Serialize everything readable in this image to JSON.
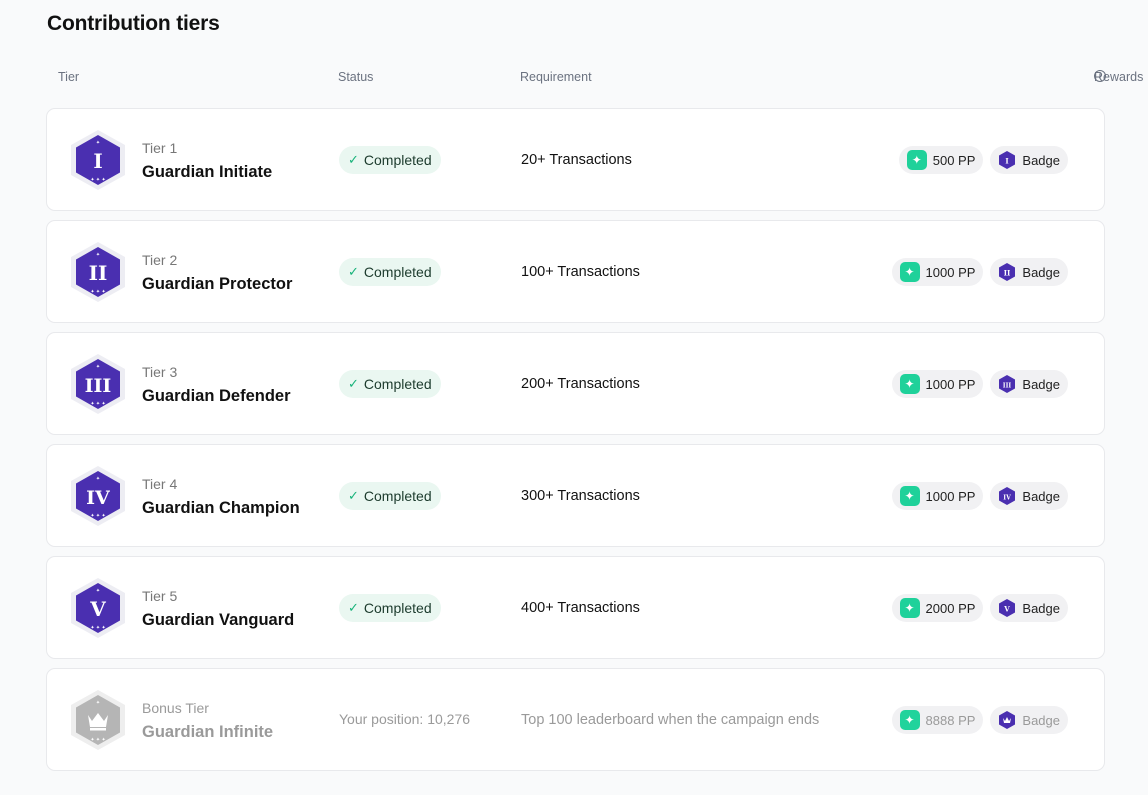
{
  "page": {
    "title": "Contribution tiers"
  },
  "columns": {
    "tier": "Tier",
    "status": "Status",
    "requirement": "Requirement",
    "rewards": "Rewards",
    "rewards_info_icon": "info-icon"
  },
  "colors": {
    "accent_green": "#1fd19a",
    "hex_purple": "#4a2fb0",
    "hex_gray": "#b5b5b5",
    "completed_bg": "#eaf7f1"
  },
  "tiers": [
    {
      "label": "Tier 1",
      "name": "Guardian Initiate",
      "numeral": "I",
      "status": "Completed",
      "requirement": "20+ Transactions",
      "pp": "500 PP",
      "badge": "Badge"
    },
    {
      "label": "Tier 2",
      "name": "Guardian Protector",
      "numeral": "II",
      "status": "Completed",
      "requirement": "100+ Transactions",
      "pp": "1000 PP",
      "badge": "Badge"
    },
    {
      "label": "Tier 3",
      "name": "Guardian Defender",
      "numeral": "III",
      "status": "Completed",
      "requirement": "200+ Transactions",
      "pp": "1000 PP",
      "badge": "Badge"
    },
    {
      "label": "Tier 4",
      "name": "Guardian Champion",
      "numeral": "IV",
      "status": "Completed",
      "requirement": "300+ Transactions",
      "pp": "1000 PP",
      "badge": "Badge"
    },
    {
      "label": "Tier 5",
      "name": "Guardian Vanguard",
      "numeral": "V",
      "status": "Completed",
      "requirement": "400+ Transactions",
      "pp": "2000 PP",
      "badge": "Badge"
    }
  ],
  "bonus": {
    "label": "Bonus Tier",
    "name": "Guardian Infinite",
    "icon": "crown-icon",
    "status": "Your position: 10,276",
    "requirement": "Top 100 leaderboard when the campaign ends",
    "pp": "8888 PP",
    "badge": "Badge"
  }
}
